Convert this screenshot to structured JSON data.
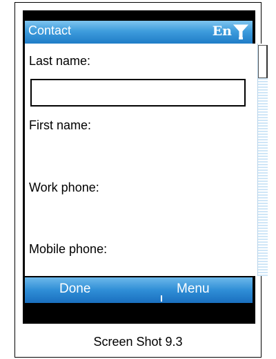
{
  "titlebar": {
    "title": "Contact",
    "lang": "En",
    "signal_icon": "signal-antenna-icon"
  },
  "form": {
    "last_name_label": "Last name:",
    "last_name_value": "",
    "first_name_label": "First name:",
    "work_phone_label": "Work phone:",
    "mobile_phone_label": "Mobile phone:"
  },
  "softkeys": {
    "left": "Done",
    "right": "Menu"
  },
  "caption": "Screen Shot 9.3",
  "colors": {
    "bar_blue": "#2f8ed6",
    "bar_light": "#7fc4ef",
    "frame_black": "#000000"
  }
}
